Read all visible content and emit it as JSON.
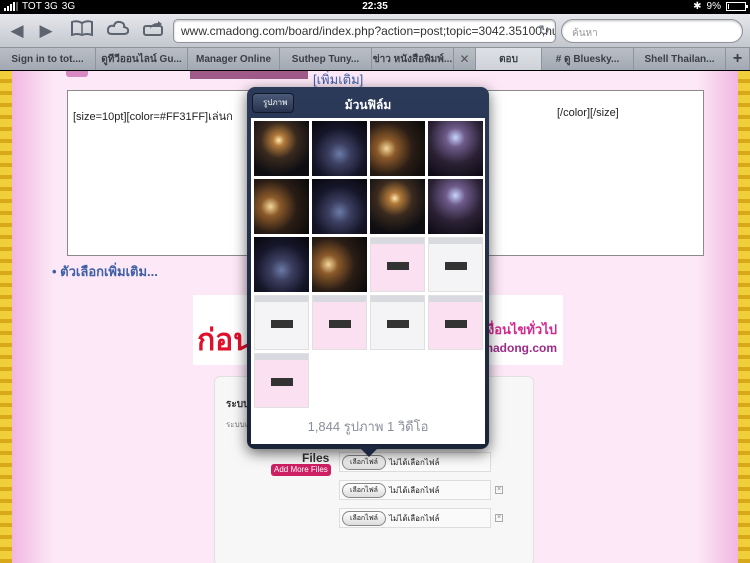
{
  "status_bar": {
    "carrier": "TOT 3G",
    "network": "3G",
    "time": "22:35",
    "battery": "9%",
    "battery_level": 0.09
  },
  "toolbar": {
    "url": "www.cmadong.com/board/index.php?action=post;topic=3042.35100;num",
    "search_placeholder": "ค้นหา"
  },
  "tabs": [
    {
      "label": "Sign in to tot...."
    },
    {
      "label": "ดูทีวีออนไลน์ Gu..."
    },
    {
      "label": "Manager Online"
    },
    {
      "label": "Suthep Tuny..."
    },
    {
      "label": "ข่าว หนังสือพิมพ์..."
    },
    {
      "label": "ตอบ"
    },
    {
      "label": "# ดู Bluesky..."
    },
    {
      "label": "Shell Thailan..."
    }
  ],
  "page": {
    "more_link": "[เพิ่มเติม]",
    "editor_text": "[size=10pt][color=#FF31FF]เล่นก",
    "editor_text_end": "[/color][/size]",
    "options_link": "• ตัวเลือกเพิ่มเติม...",
    "banner_big": "ก่อน",
    "banner_side": "เงื่อนไขทั่วไป",
    "banner_domain": "madong.com",
    "panel_title": "ระบบ",
    "panel_subtitle": "ระบบแ",
    "files_label": "Files",
    "add_more": "Add More Files",
    "file_button": "เลือกไฟล์",
    "file_status": "ไม่ได้เลือกไฟล์",
    "remove_icon": "×"
  },
  "popover": {
    "back_label": "รูปภาพ",
    "title": "ม้วนฟิล์ม",
    "count_text": "1,844 รูปภาพ 1 วิดีโอ"
  },
  "colors": {
    "accent_link": "#3e5fa8",
    "add_more_bg": "#cf1f63",
    "page_pink": "#fde8f7"
  }
}
